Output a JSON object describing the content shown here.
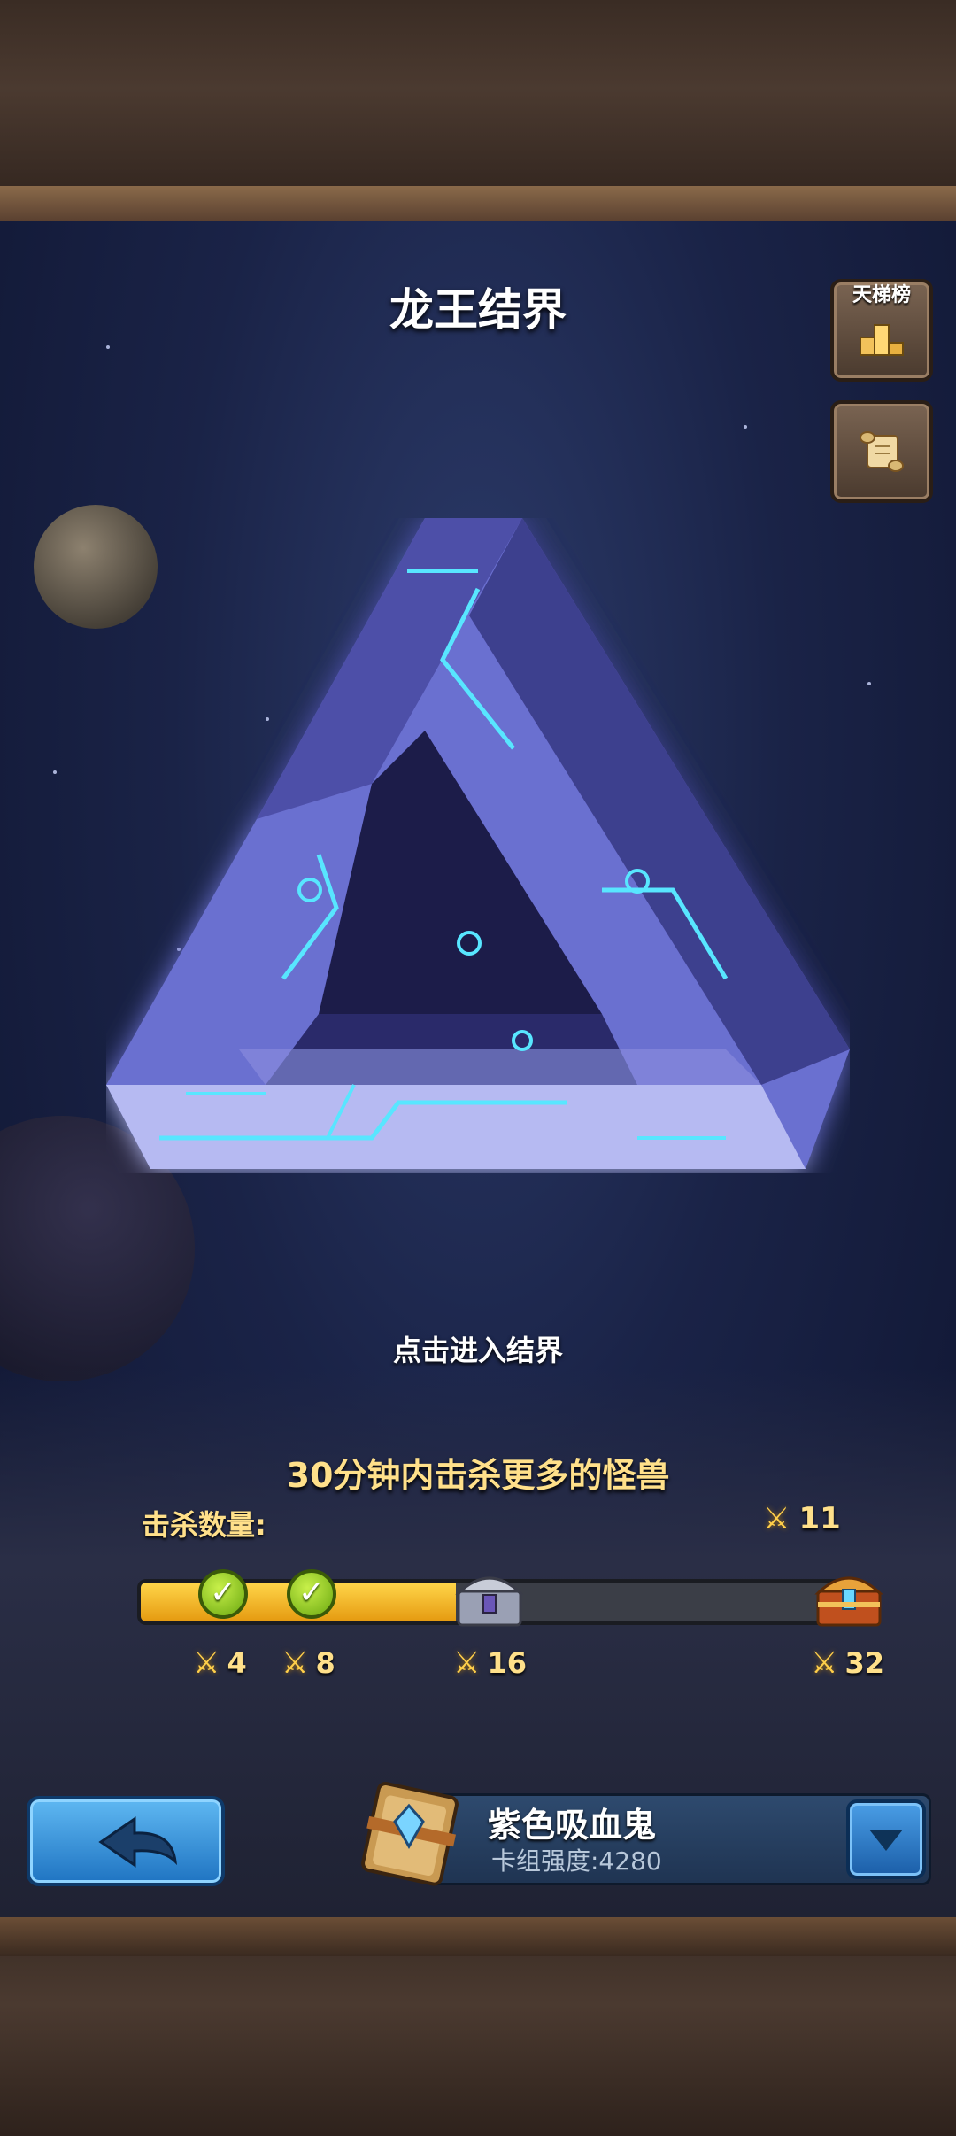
{
  "title": "龙王结界",
  "ladder_button": {
    "label": "天梯榜",
    "icon": "podium-icon"
  },
  "scroll_button": {
    "icon": "scroll-icon"
  },
  "enter_prompt": "点击进入结界",
  "objective": "30分钟内击杀更多的怪兽",
  "kills": {
    "label": "击杀数量:",
    "count": "11"
  },
  "progress": {
    "current": 11,
    "max": 32,
    "milestones": [
      {
        "value": "4",
        "claimed": true
      },
      {
        "value": "8",
        "claimed": true
      },
      {
        "value": "16",
        "claimed": false,
        "reward": "silver-chest-icon"
      },
      {
        "value": "32",
        "claimed": false,
        "reward": "gold-chest-icon"
      }
    ]
  },
  "deck": {
    "name": "紫色吸血鬼",
    "power": "卡组强度:4280"
  },
  "colors": {
    "accent_yellow": "#ffd64a",
    "text_gold": "#ffe08a",
    "button_blue": "#1f74c2",
    "triangle_glow": "#58e6ff"
  }
}
